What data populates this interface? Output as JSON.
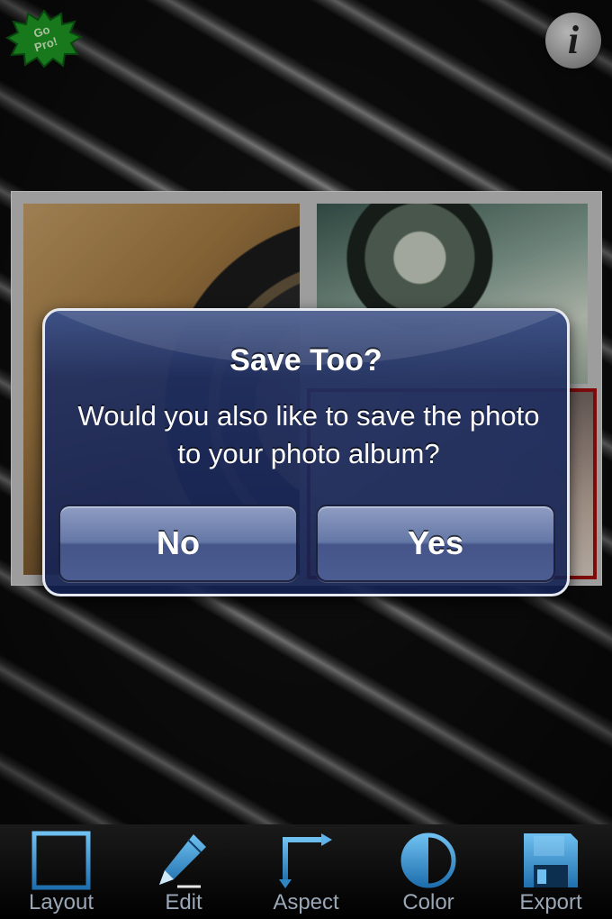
{
  "background": {
    "stripe_color": "#9a9a9a"
  },
  "badges": {
    "go_pro": {
      "text": "Go Pro!",
      "icon": "go-pro-starburst-icon",
      "color": "#1f9a24"
    },
    "info": {
      "text": "i",
      "icon": "info-icon"
    }
  },
  "collage": {
    "photos": [
      {
        "name": "headphones-closeup"
      },
      {
        "name": "headphones-earcup"
      },
      {
        "name": "headphone-jack",
        "selected": true,
        "selection_color": "#a30d0d"
      }
    ]
  },
  "alert": {
    "title": "Save Too?",
    "message": "Would you also like to save the photo to your photo album?",
    "buttons": {
      "no": "No",
      "yes": "Yes"
    }
  },
  "toolbar": {
    "accent": "#2f8fd0",
    "items": [
      {
        "label": "Layout",
        "icon": "layout-grid-icon"
      },
      {
        "label": "Edit",
        "icon": "pencil-icon"
      },
      {
        "label": "Aspect",
        "icon": "aspect-arrow-icon"
      },
      {
        "label": "Color",
        "icon": "half-circle-icon"
      },
      {
        "label": "Export",
        "icon": "floppy-disk-icon"
      }
    ]
  }
}
